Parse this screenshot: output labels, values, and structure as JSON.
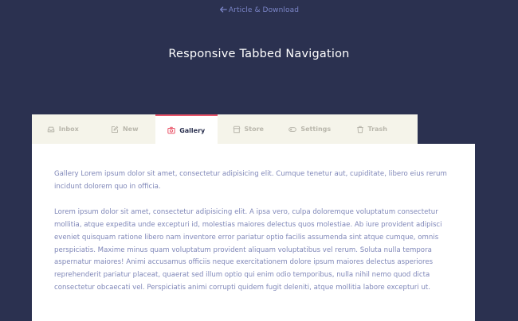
{
  "header": {
    "back_link": "Article & Download",
    "title": "Responsive Tabbed Navigation"
  },
  "tabs": [
    {
      "label": "Inbox",
      "icon": "inbox-icon",
      "active": false
    },
    {
      "label": "New",
      "icon": "edit-icon",
      "active": false
    },
    {
      "label": "Gallery",
      "icon": "camera-icon",
      "active": true
    },
    {
      "label": "Store",
      "icon": "store-icon",
      "active": false
    },
    {
      "label": "Settings",
      "icon": "toggle-icon",
      "active": false
    },
    {
      "label": "Trash",
      "icon": "trash-icon",
      "active": false
    }
  ],
  "content": {
    "paragraph1": "Gallery Lorem ipsum dolor sit amet, consectetur adipisicing elit. Cumque tenetur aut, cupiditate, libero eius rerum incidunt dolorem quo in officia.",
    "paragraph2": "Lorem ipsum dolor sit amet, consectetur adipisicing elit. A ipsa vero, culpa doloremque voluptatum consectetur mollitia, atque expedita unde excepturi id, molestias maiores delectus quos molestiae. Ab iure provident adipisci eveniet quisquam ratione libero nam inventore error pariatur optio facilis assumenda sint atque cumque, omnis perspiciatis. Maxime minus quam voluptatum provident aliquam voluptatibus vel rerum. Soluta nulla tempora aspernatur maiores! Animi accusamus officiis neque exercitationem dolore ipsum maiores delectus asperiores reprehenderit pariatur placeat, quaerat sed illum optio qui enim odio temporibus, nulla nihil nemo quod dicta consectetur obcaecati vel. Perspiciatis animi corrupti quidem fugit deleniti, atque mollitia labore excepturi ut."
  },
  "colors": {
    "background": "#2b3150",
    "tab_bar": "#f5f4ea",
    "active_accent": "#e95468",
    "link": "#7a84c6",
    "body_text": "#7f87b8"
  }
}
